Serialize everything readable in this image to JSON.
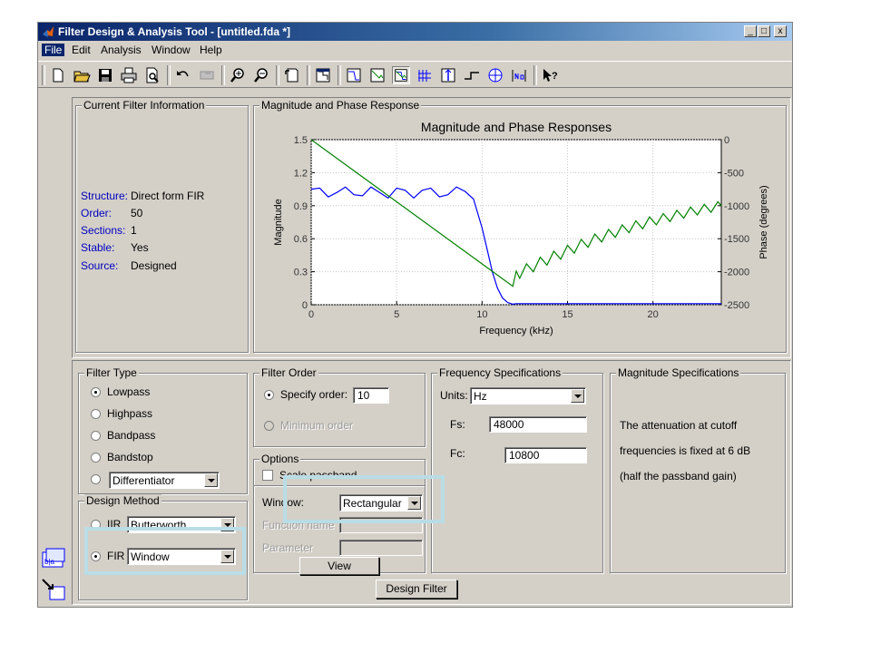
{
  "window": {
    "title": "Filter Design & Analysis Tool -  [untitled.fda *]",
    "controls": [
      "_",
      "□",
      "x"
    ]
  },
  "menubar": {
    "items": [
      "File",
      "Edit",
      "Analysis",
      "Window",
      "Help"
    ]
  },
  "toolbar": {
    "buttons": [
      "new-icon",
      "open-icon",
      "save-icon",
      "print-icon",
      "print-preview-icon",
      "undo-icon",
      "redo-icon",
      "zoom-in-icon",
      "zoom-out-icon",
      "full-view-icon",
      "filter-specs-icon",
      "magnitude-icon",
      "phase-icon",
      "magnitude-phase-icon",
      "group-delay-icon",
      "impulse-icon",
      "step-icon",
      "pole-zero-icon",
      "coefficients-icon",
      "whats-this-icon"
    ]
  },
  "current_filter": {
    "title": "Current Filter Information",
    "rows": [
      {
        "label": "Structure:",
        "value": "Direct form FIR"
      },
      {
        "label": "Order:",
        "value": "50"
      },
      {
        "label": "Sections:",
        "value": "1"
      },
      {
        "label": "Stable:",
        "value": "Yes"
      },
      {
        "label": "Source:",
        "value": "Designed"
      }
    ]
  },
  "response_panel": {
    "frame_title": "Magnitude and Phase Response"
  },
  "chart_data": {
    "type": "line",
    "title": "Magnitude and Phase  Responses",
    "xlabel": "Frequency (kHz)",
    "ylabel": "Magnitude",
    "y2label": "Phase (degrees)",
    "xlim": [
      0,
      24
    ],
    "ylim": [
      0,
      1.5
    ],
    "y2lim": [
      -2500,
      0
    ],
    "xticks": [
      "0",
      "5",
      "10",
      "15",
      "20"
    ],
    "yticks": [
      "0",
      "0.3",
      "0.6",
      "0.9",
      "1.2",
      "1.5"
    ],
    "y2ticks": [
      "-2500",
      "-2000",
      "-1500",
      "-1000",
      "-500",
      "0"
    ],
    "series": [
      {
        "color": "#0000ff",
        "axis": "left",
        "x": [
          0,
          0.5,
          1,
          1.5,
          2,
          2.5,
          3,
          3.5,
          4,
          4.5,
          5,
          5.5,
          6,
          6.5,
          7,
          7.5,
          8,
          8.5,
          9,
          9.5,
          10,
          10.3,
          10.6,
          10.9,
          11.2,
          11.5,
          11.8,
          12,
          13,
          15,
          20,
          24
        ],
        "y": [
          1.05,
          1.06,
          0.98,
          1.02,
          1.07,
          1.0,
          0.99,
          1.07,
          1.02,
          0.97,
          1.06,
          1.04,
          0.97,
          1.04,
          1.06,
          0.98,
          1.0,
          1.07,
          1.03,
          0.96,
          0.7,
          0.5,
          0.3,
          0.15,
          0.06,
          0.02,
          0.005,
          0.01,
          0.01,
          0.01,
          0.01,
          0.01
        ]
      },
      {
        "color": "#008000",
        "axis": "right",
        "x": [
          0,
          11.8,
          12.0,
          12.2,
          12.6,
          13.0,
          13.4,
          13.8,
          14.2,
          14.6,
          15.0,
          15.4,
          15.8,
          16.2,
          16.6,
          17.0,
          17.4,
          17.8,
          18.2,
          18.6,
          19.0,
          19.4,
          19.8,
          20.2,
          20.6,
          21.0,
          21.4,
          21.8,
          22.2,
          22.6,
          23.0,
          23.4,
          23.8,
          24
        ],
        "y": [
          0,
          -2220,
          -1990,
          -2100,
          -1880,
          -2000,
          -1780,
          -1900,
          -1690,
          -1810,
          -1600,
          -1720,
          -1510,
          -1630,
          -1430,
          -1550,
          -1360,
          -1480,
          -1290,
          -1410,
          -1230,
          -1350,
          -1170,
          -1290,
          -1120,
          -1240,
          -1070,
          -1190,
          -1020,
          -1140,
          -980,
          -1100,
          -940,
          -1000
        ]
      }
    ]
  },
  "filter_type": {
    "title": "Filter Type",
    "options": [
      "Lowpass",
      "Highpass",
      "Bandpass",
      "Bandstop"
    ],
    "selected": "Lowpass",
    "other_select": "Differentiator"
  },
  "design_method": {
    "title": "Design Method",
    "iir_label": "IIR",
    "iir_value": "Butterworth",
    "fir_label": "FIR",
    "fir_value": "Window"
  },
  "filter_order": {
    "title": "Filter Order",
    "specify_label": "Specify order:",
    "specify_value": "10",
    "minimum_label": "Minimum order"
  },
  "options": {
    "title": "Options",
    "scale_label": "Scale passband",
    "window_label": "Window:",
    "window_value": "Rectangular",
    "function_label": "Function name",
    "parameter_label": "Parameter",
    "view_button": "View"
  },
  "freq_specs": {
    "title": "Frequency Specifications",
    "units_label": "Units:",
    "units_value": "Hz",
    "fs_label": "Fs:",
    "fs_value": "48000",
    "fc_label": "Fc:",
    "fc_value": "10800"
  },
  "mag_specs": {
    "title": "Magnitude Specifications",
    "lines": [
      "The attenuation at cutoff",
      "frequencies is fixed at 6 dB",
      "(half the passband gain)"
    ]
  },
  "design_button": "Design Filter"
}
